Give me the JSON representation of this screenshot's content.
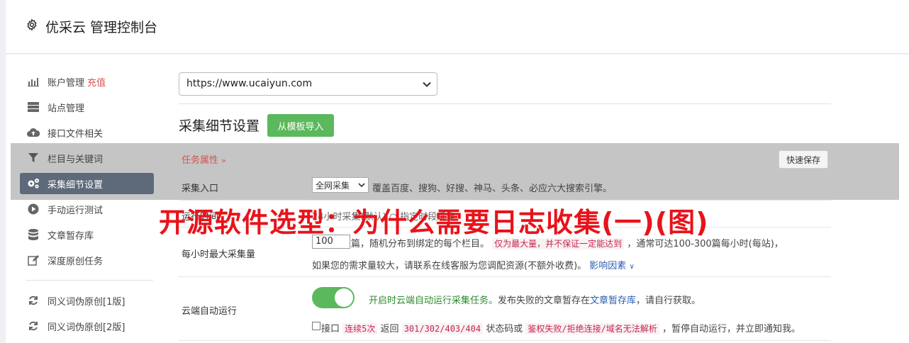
{
  "app": {
    "title": "优采云 管理控制台"
  },
  "sidebar": {
    "items": [
      {
        "label": "账户管理",
        "extra": "充值"
      },
      {
        "label": "站点管理"
      },
      {
        "label": "接口文件相关"
      },
      {
        "label": "栏目与关键词"
      },
      {
        "label": "采集细节设置"
      },
      {
        "label": "手动运行测试"
      },
      {
        "label": "文章暂存库"
      },
      {
        "label": "深度原创任务"
      },
      {
        "label": "同义词伪原创[1版]"
      },
      {
        "label": "同义词伪原创[2版]"
      }
    ],
    "active_index": 4
  },
  "site_select": {
    "value": "https://www.ucaiyun.com"
  },
  "section": {
    "title": "采集细节设置",
    "import_button": "从模板导入"
  },
  "task_bar": {
    "label": "任务属性",
    "quick_save": "快速保存"
  },
  "rows": {
    "entry": {
      "label": "采集入口",
      "select_value": "全网采集",
      "desc": "覆盖百度、搜狗、好搜、神马、头条、必应六大搜索引擎。"
    },
    "time": {
      "label": "运行时间",
      "desc": "24小时采集(默认) ○ 指定时段采集"
    },
    "max": {
      "label": "每小时最大采集量",
      "input_value": "100",
      "text1": "篇，随机分布到绑定的每个栏目。",
      "code1": "仅为最大量，并不保证一定能达到",
      "text2": "，通常可达100-300篇每小时(每站)，",
      "text3": "如果您的需求量较大，请联系在线客服为您调配资源(不额外收费)。",
      "link": "影响因素"
    },
    "cloud": {
      "label": "云端自动运行",
      "green": "开启时云端自动运行采集任务。",
      "text1": "发布失败的文章暂存在",
      "link": "文章暂存库",
      "text2": "，请自行获取。",
      "chk_label": "接口",
      "code1": "连续5次",
      "text3": "返回",
      "code2": "301/302/403/404",
      "text4": "状态码或",
      "code3": "鉴权失败/拒绝连接/域名无法解析",
      "text5": "，暂停自动运行，并立即通知我。"
    }
  },
  "overlay": {
    "title": "开源软件选型：为什么需要日志收集(一)(图)"
  }
}
